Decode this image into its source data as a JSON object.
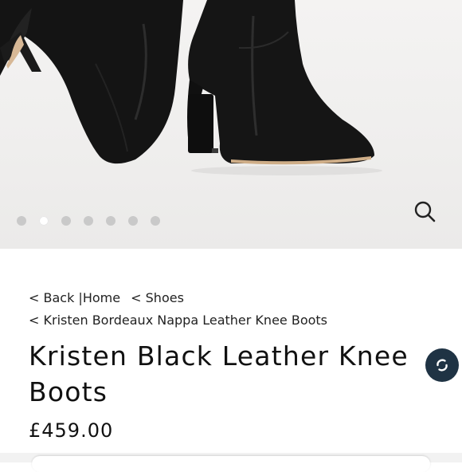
{
  "gallery": {
    "slide_count": 7,
    "active_index": 1,
    "zoom_icon": "search-icon"
  },
  "breadcrumb": {
    "back_label": "< Back |Home",
    "shoes_label": "< Shoes",
    "current_label": "<  Kristen Bordeaux Nappa Leather Knee Boots"
  },
  "product": {
    "title": "Kristen Black Leather Knee Boots",
    "price": "£459.00"
  },
  "chat": {
    "icon": "chat-icon",
    "color": "#1f3344"
  }
}
